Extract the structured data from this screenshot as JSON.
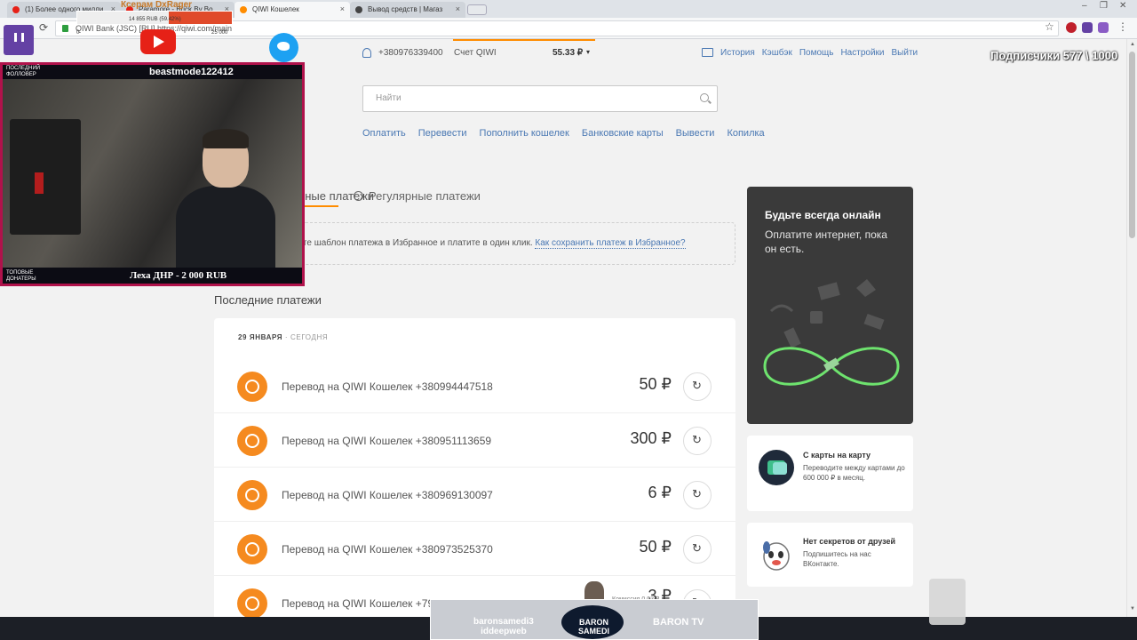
{
  "browser": {
    "tabs": [
      {
        "label": "(1) Более одного милли",
        "favicon_color": "#e62117"
      },
      {
        "label": "Paramore - Brick By Bo",
        "favicon_color": "#e62117"
      },
      {
        "label": "QIWI Кошелек",
        "favicon_color": "#ff8c00"
      },
      {
        "label": "Вывод средств | Магаз",
        "favicon_color": "#444444"
      }
    ],
    "close_glyph": "×",
    "address": "QIWI Bank (JSC) [RU]  https://qiwi.com/main",
    "star_glyph": "☆",
    "reload_glyph": "⟳",
    "menu_glyph": "⋮",
    "window_controls": [
      "–",
      "❐",
      "✕"
    ]
  },
  "header": {
    "phone": "+380976339400",
    "account_label": "Счет QIWI",
    "balance": "55.33 ₽",
    "caret": "▾",
    "links": [
      "История",
      "Кэшбэк",
      "Помощь",
      "Настройки",
      "Выйти"
    ]
  },
  "search": {
    "placeholder": "Найти"
  },
  "main_nav": [
    "Оплатить",
    "Перевести",
    "Пополнить кошелек",
    "Банковские карты",
    "Вывести",
    "Копилка"
  ],
  "tabs": {
    "payments": "Избранные платежи",
    "regular": "Регулярные платежи"
  },
  "hint": {
    "text": "Сохраните шаблон платежа в Избранное и платите в один клик. ",
    "link": "Как сохранить платеж в Избранное?"
  },
  "recent": {
    "title": "Последние платежи",
    "date": "29 ЯНВАРЯ",
    "date_suffix": " · СЕГОДНЯ",
    "rows": [
      {
        "desc": "Перевод на QIWI Кошелек +380994447518",
        "amount": "50 ₽"
      },
      {
        "desc": "Перевод на QIWI Кошелек +380951113659",
        "amount": "300 ₽"
      },
      {
        "desc": "Перевод на QIWI Кошелек +380969130097",
        "amount": "6 ₽"
      },
      {
        "desc": "Перевод на QIWI Кошелек +380973525370",
        "amount": "50 ₽"
      },
      {
        "desc": "Перевод на QIWI Кошелек +79639454437",
        "amount": "3 ₽"
      }
    ],
    "commission": "Комиссия 0.03 ₽"
  },
  "promos": {
    "online": {
      "title": "Будьте всегда онлайн",
      "text": "Оплатите интернет, пока он есть."
    },
    "card_to_card": {
      "title": "С карты на карту",
      "text": "Переводите между картами до 600 000 ₽ в месяц."
    },
    "friends": {
      "title": "Нет секретов от друзей",
      "text": "Подпишитесь на нас ВКонтакте."
    }
  },
  "overlay": {
    "donate_title": "Ксерам DxRager",
    "donate_amount": "14 855 RUB (59.42%)",
    "donate_min": "0",
    "donate_max": "25 000",
    "donate_progress": 0.5942,
    "follow_label": "ПОСЛЕДНИЙ\nФОЛЛОВЕР",
    "follow_name": "beastmode122412",
    "top_label": "ТОПОВЫЕ\nДОНАТЕРЫ",
    "top_name": "Леха ДНР - 2 000 RUB",
    "subs": "Подписчики 577 \\ 1000",
    "stream_left": "baronsamedi3\niddeepweb",
    "stream_mid": "BARON\nSAMEDI",
    "stream_right": "BARON TV"
  },
  "colors": {
    "accent": "#ff8c00",
    "link": "#4a78b3",
    "qiwi": "#f58a1f"
  }
}
